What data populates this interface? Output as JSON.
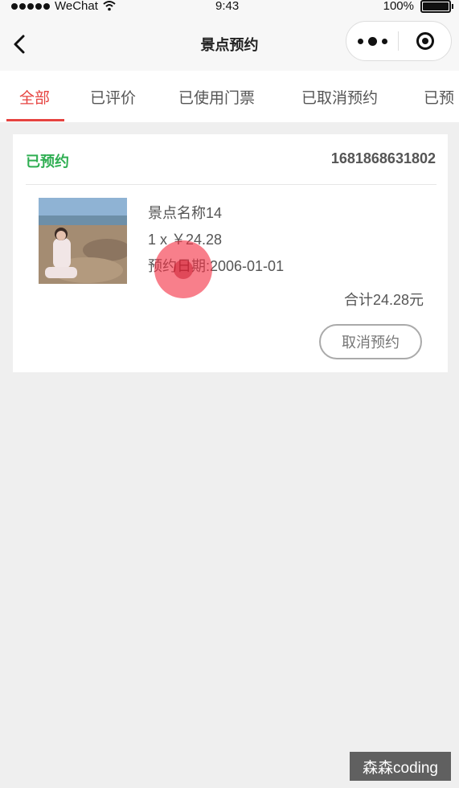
{
  "status_bar": {
    "carrier": "WeChat",
    "time": "9:43",
    "battery": "100%"
  },
  "nav": {
    "title": "景点预约"
  },
  "tabs": [
    {
      "label": "全部",
      "active": true
    },
    {
      "label": "已评价"
    },
    {
      "label": "已使用门票"
    },
    {
      "label": "已取消预约"
    },
    {
      "label": "已预"
    }
  ],
  "order": {
    "status": "已预约",
    "order_no": "1681868631802",
    "name": "景点名称14",
    "price_line": "1 x ￥24.28",
    "date_line": "预约日期:2006-01-01",
    "total": "合计24.28元",
    "cancel_label": "取消预约"
  },
  "watermark": "森森coding",
  "colors": {
    "accent": "#e64340",
    "status_green": "#2fae52",
    "background": "#efefef"
  }
}
